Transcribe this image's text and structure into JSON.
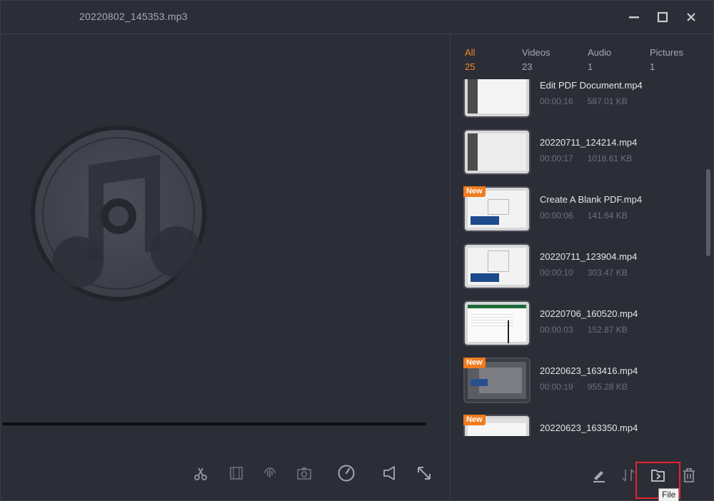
{
  "window": {
    "title": "20220802_145353.mp3"
  },
  "tabs": [
    {
      "label": "All",
      "count": "25"
    },
    {
      "label": "Videos",
      "count": "23"
    },
    {
      "label": "Audio",
      "count": "1"
    },
    {
      "label": "Pictures",
      "count": "1"
    }
  ],
  "items": [
    {
      "name": "Edit PDF Document.mp4",
      "duration": "00:00:16",
      "size": "587.01 KB",
      "badge": ""
    },
    {
      "name": "20220711_124214.mp4",
      "duration": "00:00:17",
      "size": "1018.61 KB",
      "badge": ""
    },
    {
      "name": "Create A Blank PDF.mp4",
      "duration": "00:00:06",
      "size": "141.64 KB",
      "badge": "New"
    },
    {
      "name": "20220711_123904.mp4",
      "duration": "00:00:10",
      "size": "303.47 KB",
      "badge": ""
    },
    {
      "name": "20220706_160520.mp4",
      "duration": "00:00:03",
      "size": "152.87 KB",
      "badge": ""
    },
    {
      "name": "20220623_163416.mp4",
      "duration": "00:00:19",
      "size": "955.28 KB",
      "badge": "New"
    },
    {
      "name": "20220623_163350.mp4",
      "duration": "",
      "size": "",
      "badge": "New"
    }
  ],
  "tooltip": {
    "text": "File"
  },
  "colors": {
    "accent": "#f08a24",
    "badge": "#f07b1e",
    "highlight": "#e8232b",
    "background": "#2b2d37"
  }
}
